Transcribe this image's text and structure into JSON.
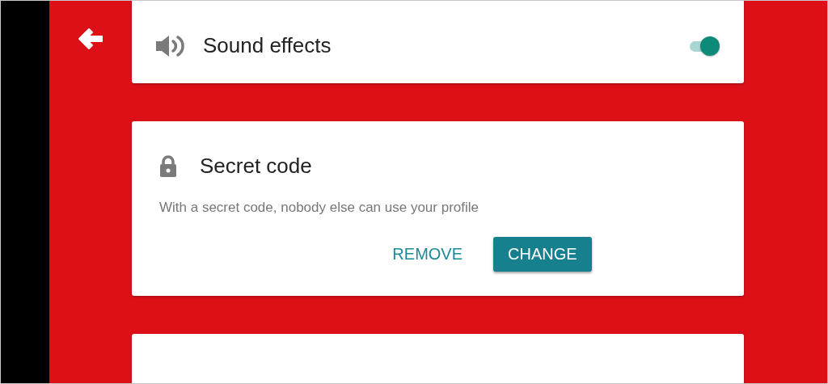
{
  "settings": [
    {
      "kind": "toggle",
      "title": "Sound effects",
      "on": true
    },
    {
      "kind": "action",
      "title": "Secret code",
      "description": "With a secret code, nobody else can use your profile",
      "buttons": [
        {
          "kind": "text",
          "label": "REMOVE"
        },
        {
          "kind": "filled",
          "label": "CHANGE"
        }
      ]
    }
  ]
}
